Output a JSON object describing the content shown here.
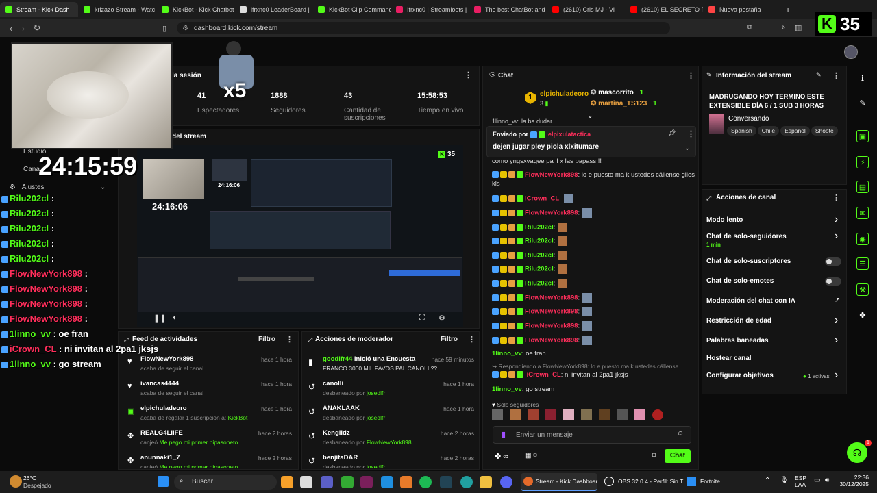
{
  "browser": {
    "tabs": [
      {
        "label": "Stream - Kick Dash",
        "color": "#53fc18",
        "active": true
      },
      {
        "label": "krizazo Stream - Watc",
        "color": "#53fc18"
      },
      {
        "label": "KickBot - Kick Chatbot",
        "color": "#53fc18"
      },
      {
        "label": "ifrxnc0 LeaderBoard |",
        "color": "#dddddd"
      },
      {
        "label": "KickBot Clip Command",
        "color": "#53fc18"
      },
      {
        "label": "Ifrxnc0 | Streamloots |",
        "color": "#e91e63"
      },
      {
        "label": "The best ChatBot and",
        "color": "#e91e63"
      },
      {
        "label": "(2610) Cris MJ - Vi",
        "color": "#ff0000"
      },
      {
        "label": "(2610) EL SECRETO FI",
        "color": "#ff0000"
      },
      {
        "label": "Nueva pestaña",
        "color": "#ff4444"
      }
    ],
    "new_tab": "+",
    "url": "dashboard.kick.com/stream"
  },
  "overlay": {
    "kick_count": "35",
    "multiplier": "x5",
    "timer": "24:15:59",
    "chat_lines": [
      {
        "user": "Rilu202cl",
        "msg": "",
        "color": "#53fc18"
      },
      {
        "user": "Rilu202cl",
        "msg": "",
        "color": "#53fc18"
      },
      {
        "user": "Rilu202cl",
        "msg": "",
        "color": "#53fc18"
      },
      {
        "user": "Rilu202cl",
        "msg": "",
        "color": "#53fc18"
      },
      {
        "user": "Rilu202cl",
        "msg": "",
        "color": "#53fc18"
      },
      {
        "user": "FlowNewYork898",
        "msg": "",
        "color": "#ff2e5b"
      },
      {
        "user": "FlowNewYork898",
        "msg": "",
        "color": "#ff2e5b"
      },
      {
        "user": "FlowNewYork898",
        "msg": "",
        "color": "#ff2e5b"
      },
      {
        "user": "FlowNewYork898",
        "msg": "",
        "color": "#ff2e5b"
      },
      {
        "user": "1linno_vv",
        "msg": "oe fran",
        "color": "#53fc18"
      },
      {
        "user": "iCrown_CL",
        "msg": "ni invitan al 2pa1 jksjs",
        "color": "#ff2e5b"
      },
      {
        "user": "1linno_vv",
        "msg": "go stream",
        "color": "#53fc18"
      }
    ],
    "menu": [
      "Estudio",
      "Cana",
      "Ajustes"
    ]
  },
  "session": {
    "title": "la sesión",
    "stats": [
      {
        "value": "41",
        "label": "Espectadores"
      },
      {
        "value": "1888",
        "label": "Seguidores"
      },
      {
        "value": "43",
        "label": "Cantidad de suscripciones"
      },
      {
        "value": "15:58:53",
        "label": "Tiempo en vivo"
      }
    ]
  },
  "preview": {
    "title": "del stream",
    "inner_count": "35",
    "inner_timer": "24:16:06",
    "inner_timer2": "24:16:06"
  },
  "activity_feed": {
    "title": "Feed de actividades",
    "filter": "Filtro",
    "items": [
      {
        "name": "FlowNewYork898",
        "desc": "acaba de seguir el canal",
        "time": "hace 1 hora"
      },
      {
        "name": "ivancas4444",
        "desc": "acaba de seguir el canal",
        "time": "hace 1 hora"
      },
      {
        "name": "elpichuladeoro",
        "desc": "acaba de regalar 1 suscripción a: ",
        "extra": "KickBot",
        "time": "hace 1 hora"
      },
      {
        "name": "REALG4LIIFE",
        "desc": "canjeó ",
        "extra": "Me pego mi primer pipasoneto",
        "time": "hace 2 horas"
      },
      {
        "name": "anunnaki1_7",
        "desc": "canjeó ",
        "extra": "Me pego mi primer pipasoneto",
        "time": "hace 2 horas"
      }
    ]
  },
  "mod_actions": {
    "title": "Acciones de moderador",
    "filter": "Filtro",
    "items": [
      {
        "name": "goodlfr44",
        "action": " inició una Encuesta",
        "desc": "FRANCO 3000 MIL PAVOS PAL CANOLI ??",
        "time": "hace 59 minutos"
      },
      {
        "name": "canolli",
        "desc": "desbaneado por ",
        "by": "josedlfr",
        "time": "hace 1 hora"
      },
      {
        "name": "ANAKLAAK",
        "desc": "desbaneado por ",
        "by": "josedlfr",
        "time": "hace 1 hora"
      },
      {
        "name": "Kenglidz",
        "desc": "desbaneado por ",
        "by": "FlowNewYork898",
        "time": "hace 2 horas"
      },
      {
        "name": "benjitaDAR",
        "desc": "desbaneado por ",
        "by": "josedlfr",
        "time": "hace 2 horas"
      }
    ]
  },
  "chat": {
    "title": "Chat",
    "top_gifter": {
      "rank": "1",
      "name": "elpichuladeoro",
      "count": "3"
    },
    "gifters": [
      {
        "name": "mascorrito",
        "count": "1"
      },
      {
        "name": "martina_TS123",
        "count": "1"
      }
    ],
    "partial_line": "1linno_vv: la ba dudar",
    "pinned": {
      "sent_by_label": "Enviado por",
      "sender": "elpixulatactica",
      "message": "dejen jugar pley piola xlxitumare"
    },
    "messages": [
      {
        "user": "",
        "text": "como yngsxvagee pa ll x las papass !!",
        "color": "#ddd"
      },
      {
        "user": "FlowNewYork898",
        "text": ": lo e puesto ma k ustedes cállense giles",
        "color": "#ff2e5b"
      },
      {
        "user": "",
        "text": "kls",
        "color": "#ddd"
      },
      {
        "user": "iCrown_CL",
        "text": ":",
        "color": "#ff2e5b"
      },
      {
        "user": "FlowNewYork898",
        "text": ":",
        "color": "#ff2e5b"
      },
      {
        "user": "Rilu202cl",
        "text": ":",
        "color": "#53fc18"
      },
      {
        "user": "Rilu202cl",
        "text": ":",
        "color": "#53fc18"
      },
      {
        "user": "Rilu202cl",
        "text": ":",
        "color": "#53fc18"
      },
      {
        "user": "Rilu202cl",
        "text": ":",
        "color": "#53fc18"
      },
      {
        "user": "Rilu202cl",
        "text": ":",
        "color": "#53fc18"
      },
      {
        "user": "FlowNewYork898",
        "text": ":",
        "color": "#ff2e5b"
      },
      {
        "user": "FlowNewYork898",
        "text": ":",
        "color": "#ff2e5b"
      },
      {
        "user": "FlowNewYork898",
        "text": ":",
        "color": "#ff2e5b"
      },
      {
        "user": "FlowNewYork898",
        "text": ":",
        "color": "#ff2e5b"
      },
      {
        "user": "1linno_vv",
        "text": ": oe fran",
        "color": "#53fc18"
      }
    ],
    "reply_to": "Respondiendo a FlowNewYork898: lo e puesto ma k ustedes cállense ...",
    "reply_user": "iCrown_CL",
    "reply_text": ": ni invitan al 2pa1 jksjs",
    "last": {
      "user": "1linno_vv",
      "text": ": go stream"
    },
    "followers_label": "Solo seguidores",
    "input_placeholder": "Enviar un mensaje",
    "send_label": "Chat",
    "viewer_count": "0"
  },
  "stream_info": {
    "title": "Información del stream",
    "stream_title": "MADRUGANDO HOY TERMINO ESTE EXTENSIBLE DÍA 6 / 1 SUB 3 HORAS",
    "category": "Conversando",
    "tags": [
      "Spanish",
      "Chile",
      "Español",
      "Shoote"
    ]
  },
  "channel_actions": {
    "title": "Acciones de canal",
    "items": [
      {
        "label": "Modo lento",
        "type": "chevron"
      },
      {
        "label": "Chat de solo-seguidores",
        "sub": "1 min",
        "type": "chevron"
      },
      {
        "label": "Chat de solo-suscriptores",
        "type": "toggle"
      },
      {
        "label": "Chat de solo-emotes",
        "type": "toggle"
      },
      {
        "label": "Moderación del chat con IA",
        "type": "link"
      },
      {
        "label": "Restricción de edad",
        "type": "chevron"
      },
      {
        "label": "Palabras baneadas",
        "type": "chevron"
      },
      {
        "label": "Hostear canal",
        "type": "none"
      },
      {
        "label": "Configurar objetivos",
        "status": "1 activas",
        "type": "chevron"
      }
    ]
  },
  "taskbar": {
    "weather_temp": "26°C",
    "weather_desc": "Despejado",
    "search": "Buscar",
    "apps": [
      {
        "label": "Stream - Kick Dashboar"
      },
      {
        "label": "OBS 32.0.4 - Perfil: Sin T"
      },
      {
        "label": "Fortnite"
      }
    ],
    "lang": "ESP",
    "lang2": "LAA",
    "time": "22:36",
    "date": "30/12/2025"
  },
  "colors": {
    "kick_green": "#53fc18",
    "alert_red": "#ff2e5b"
  }
}
